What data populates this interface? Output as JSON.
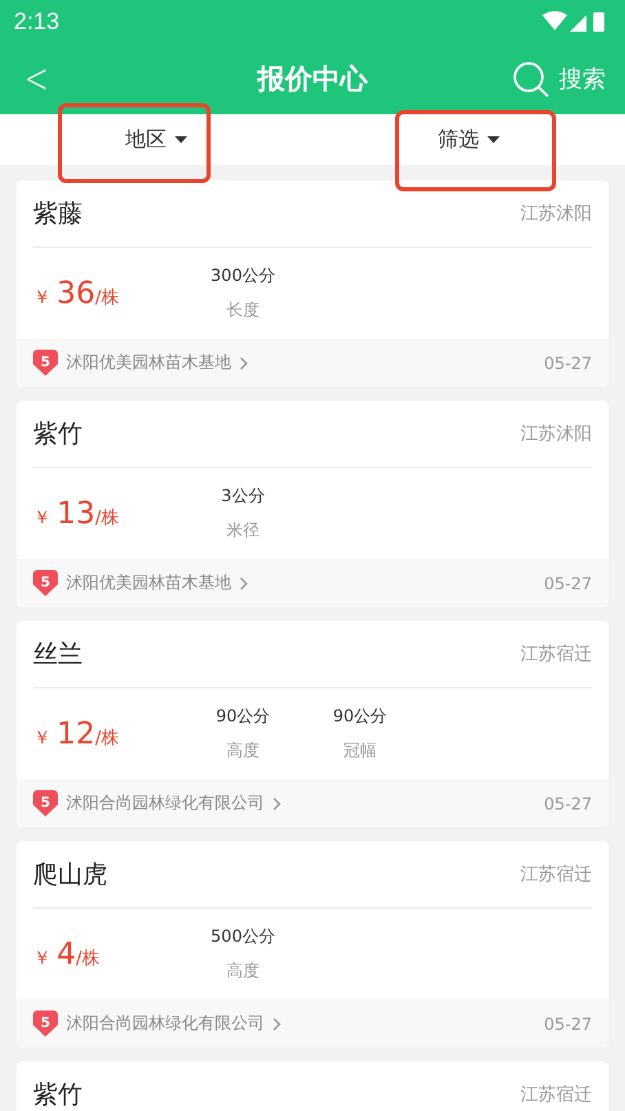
{
  "status_bar": {
    "time": "2:13"
  },
  "header": {
    "back": "<",
    "title": "报价中心",
    "search": "搜索"
  },
  "filters": [
    {
      "label": "地区",
      "highlighted": true
    },
    {
      "label": "筛选",
      "highlighted": true
    }
  ],
  "listings": [
    {
      "name": "紫藤",
      "location": "江苏沭阳",
      "currency": "￥",
      "price": "36",
      "unit": "/株",
      "specs": [
        {
          "value": "300公分",
          "label": "长度"
        }
      ],
      "badge": "5",
      "seller": "沭阳优美园林苗木基地",
      "date": "05-27"
    },
    {
      "name": "紫竹",
      "location": "江苏沭阳",
      "currency": "￥",
      "price": "13",
      "unit": "/株",
      "specs": [
        {
          "value": "3公分",
          "label": "米径"
        }
      ],
      "badge": "5",
      "seller": "沭阳优美园林苗木基地",
      "date": "05-27"
    },
    {
      "name": "丝兰",
      "location": "江苏宿迁",
      "currency": "￥",
      "price": "12",
      "unit": "/株",
      "specs": [
        {
          "value": "90公分",
          "label": "高度"
        },
        {
          "value": "90公分",
          "label": "冠幅"
        }
      ],
      "badge": "5",
      "seller": "沭阳合尚园林绿化有限公司",
      "date": "05-27"
    },
    {
      "name": "爬山虎",
      "location": "江苏宿迁",
      "currency": "￥",
      "price": "4",
      "unit": "/株",
      "specs": [
        {
          "value": "500公分",
          "label": "高度"
        }
      ],
      "badge": "5",
      "seller": "沭阳合尚园林绿化有限公司",
      "date": "05-27"
    },
    {
      "name": "紫竹",
      "location": "江苏宿迁"
    }
  ]
}
